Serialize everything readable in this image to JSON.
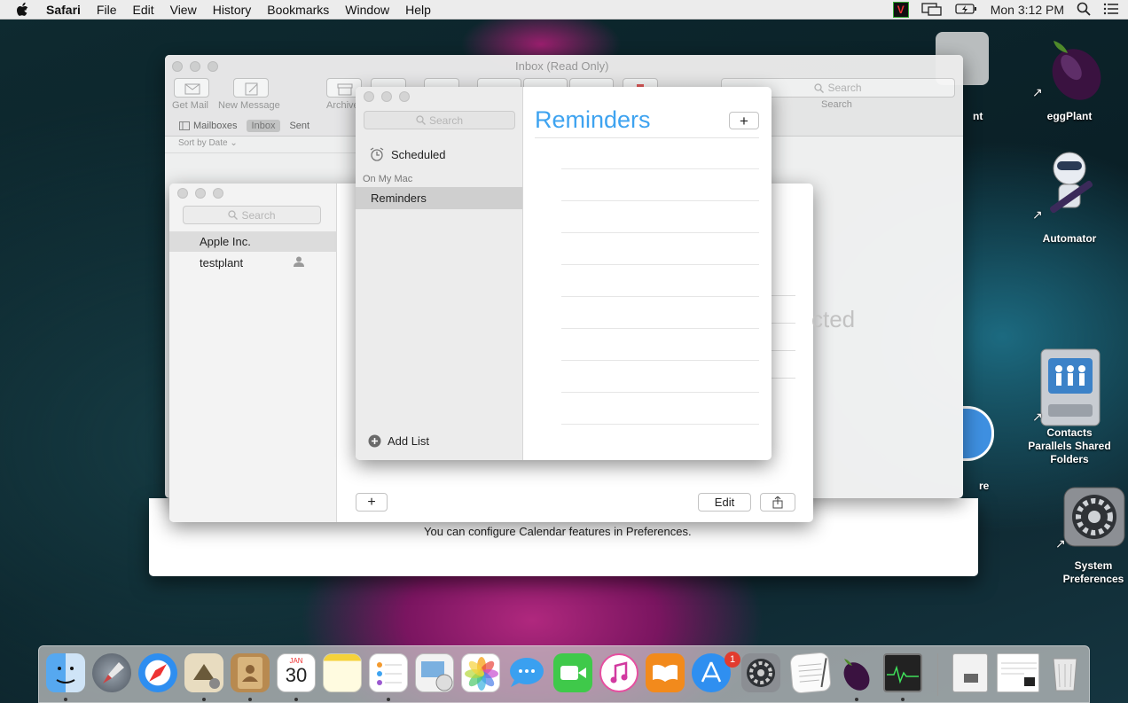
{
  "menubar": {
    "app": "Safari",
    "items": [
      "File",
      "Edit",
      "View",
      "History",
      "Bookmarks",
      "Window",
      "Help"
    ],
    "clock": "Mon 3:12 PM",
    "vnc_label": "V"
  },
  "mail": {
    "title": "Inbox (Read Only)",
    "get_mail": "Get Mail",
    "new_message": "New Message",
    "archive": "Archive",
    "mailboxes": "Mailboxes",
    "inbox": "Inbox",
    "sent": "Sent",
    "sort": "Sort by Date",
    "search_placeholder": "Search",
    "search_label": "Search"
  },
  "calendar": {
    "footer": "You can configure Calendar features in Preferences."
  },
  "contacts": {
    "search_placeholder": "Search",
    "items": [
      "Apple Inc.",
      "testplant"
    ],
    "edit": "Edit",
    "partial_text": "cted",
    "add_symbol": "+"
  },
  "reminders": {
    "search_placeholder": "Search",
    "scheduled": "Scheduled",
    "section": "On My Mac",
    "list": "Reminders",
    "title": "Reminders",
    "add_list": "Add List",
    "add_symbol": "+"
  },
  "desktop": {
    "icons": [
      {
        "label": "eggPlant"
      },
      {
        "label": "Automator"
      },
      {
        "label": "Contacts\nParallels Shared\nFolders"
      },
      {
        "label": "System\nPreferences"
      }
    ],
    "partial_labels": [
      "nt",
      "re"
    ]
  },
  "dock": {
    "calendar_month": "JAN",
    "calendar_day": "30",
    "appstore_badge": "1"
  },
  "colors": {
    "reminders_accent": "#3ea3f0",
    "badge": "#e23b2e"
  }
}
